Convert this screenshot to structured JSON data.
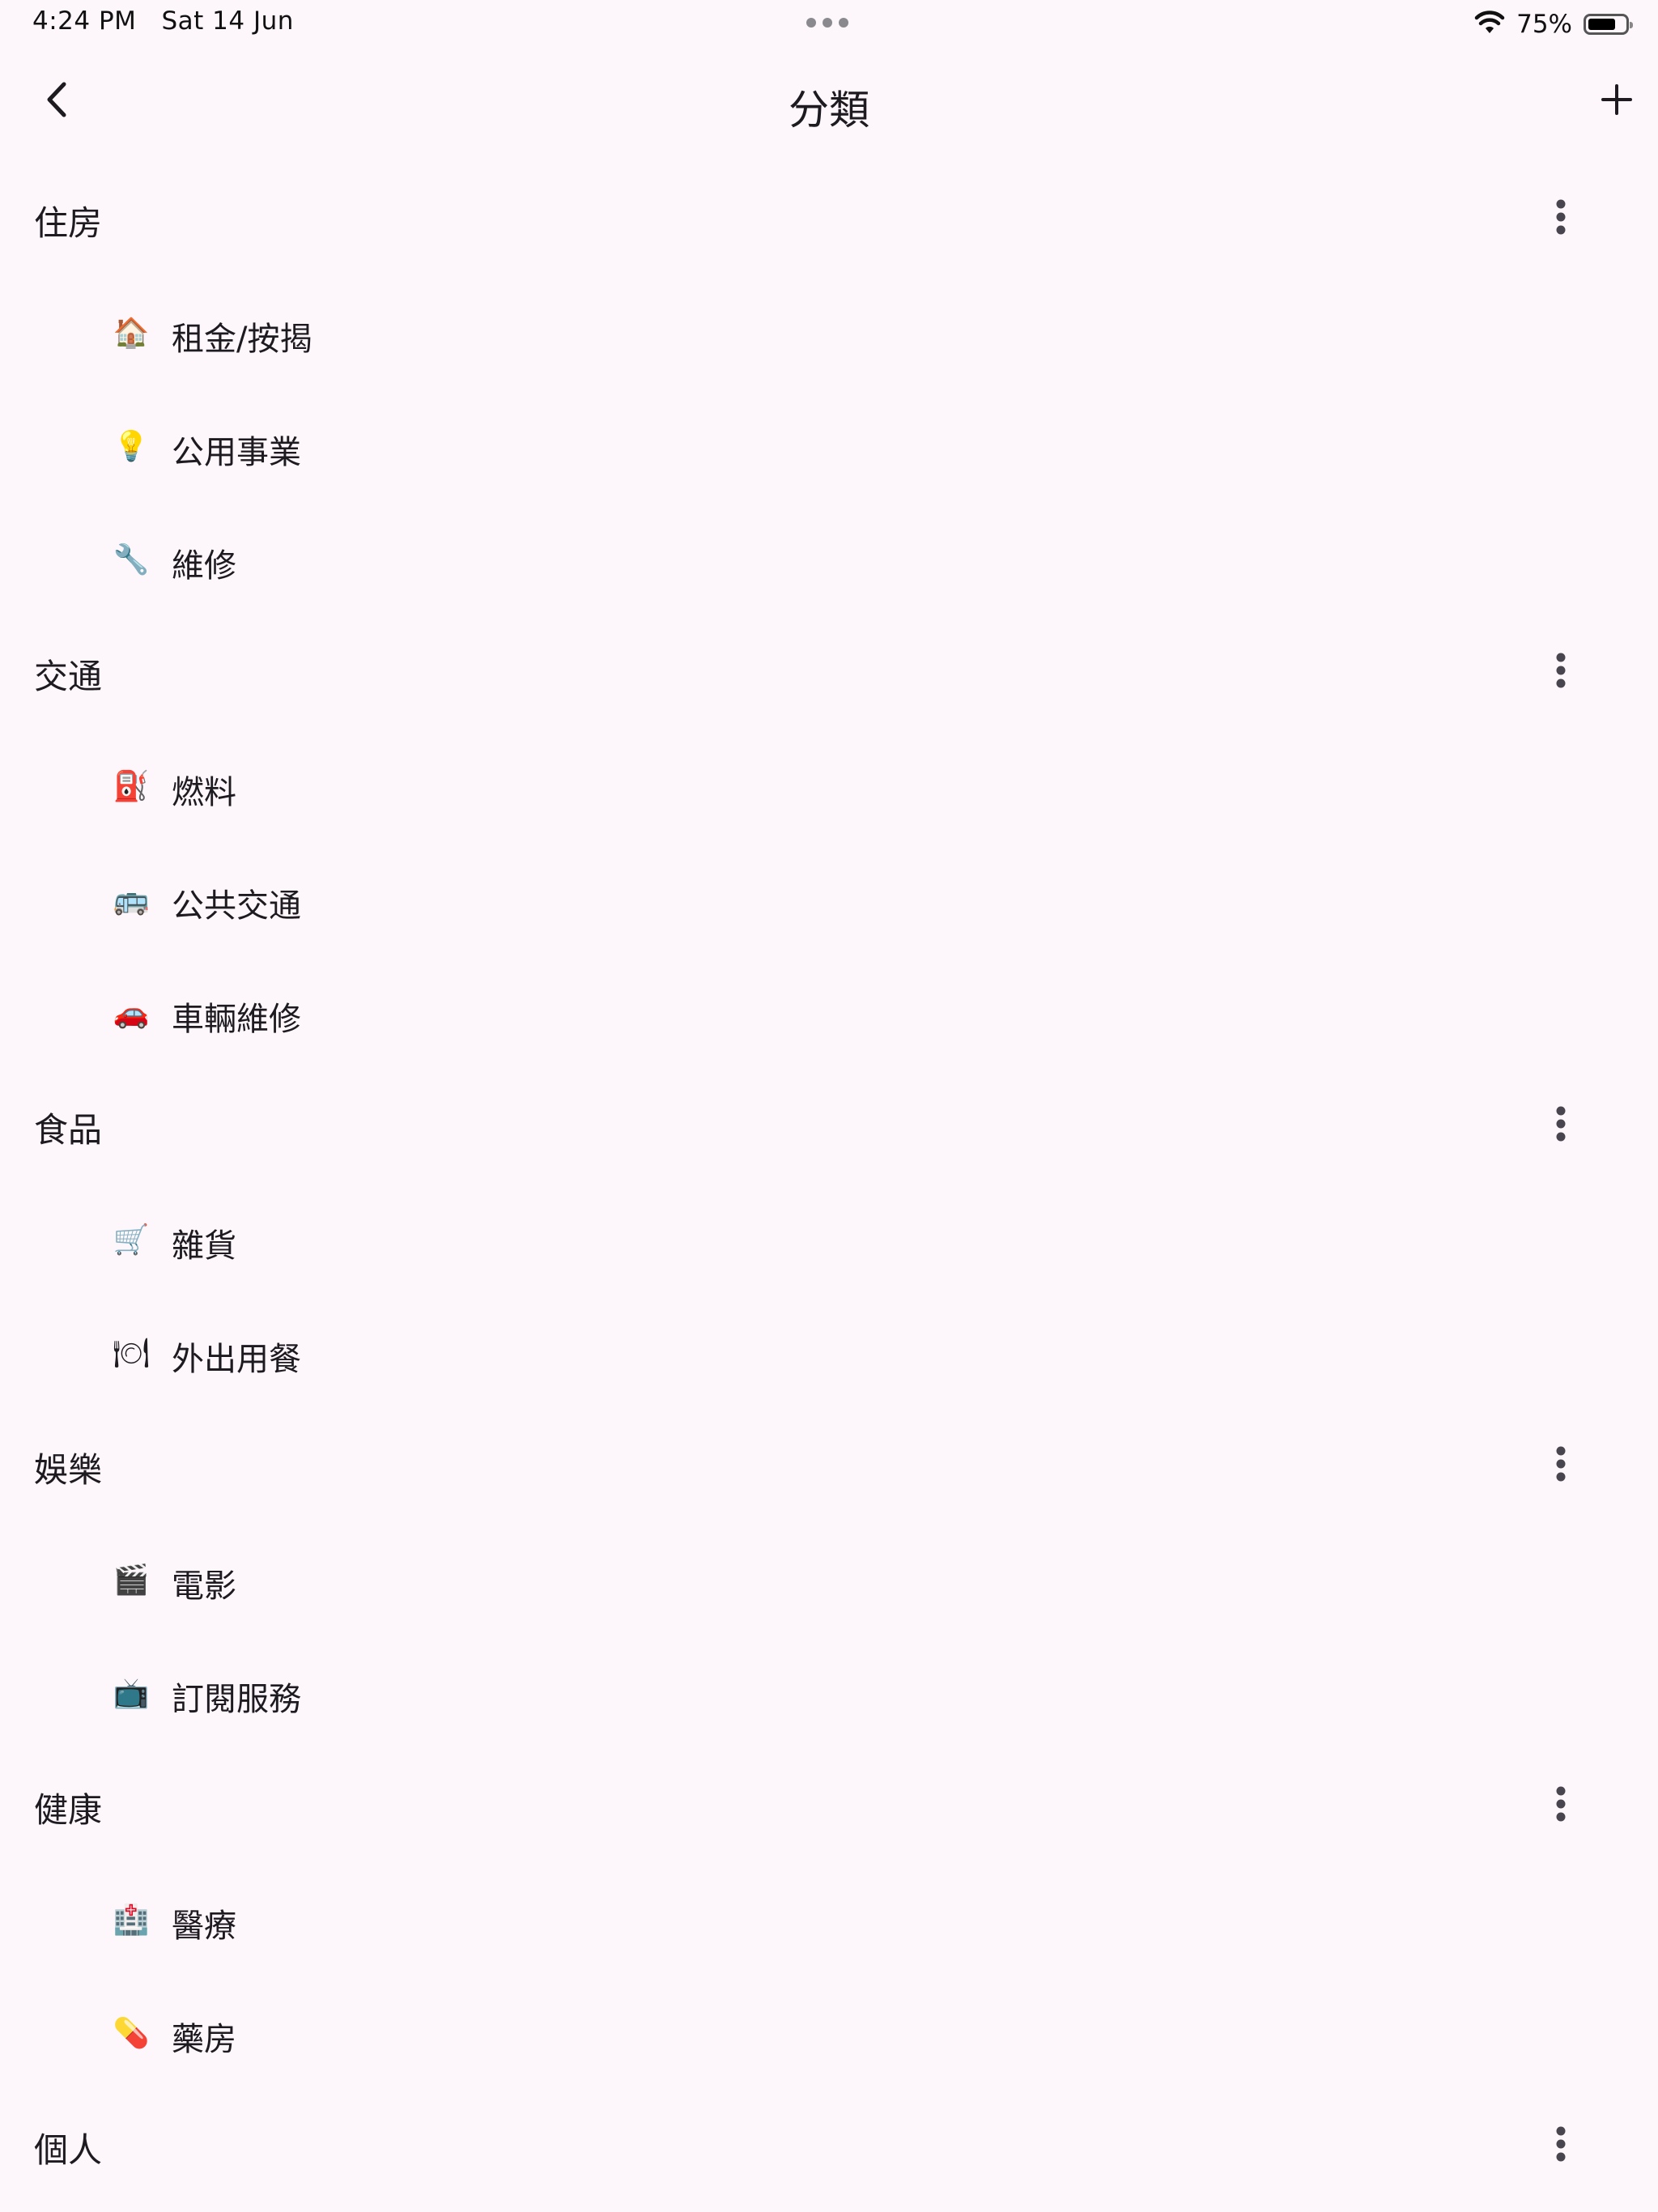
{
  "status_bar": {
    "time": "4:24 PM",
    "date": "Sat 14 Jun",
    "battery_percent": "75%",
    "battery_level": 0.75,
    "wifi_icon": "wifi-icon"
  },
  "app_bar": {
    "title": "分類",
    "back_icon": "back-arrow-icon",
    "add_icon": "add-icon"
  },
  "groups": [
    {
      "title": "住房",
      "items": [
        {
          "label": "租金/按揭",
          "icon": "house-icon",
          "emoji": "🏠"
        },
        {
          "label": "公用事業",
          "icon": "lightbulb-icon",
          "emoji": "💡"
        },
        {
          "label": "維修",
          "icon": "wrench-icon",
          "emoji": "🔧"
        }
      ]
    },
    {
      "title": "交通",
      "items": [
        {
          "label": "燃料",
          "icon": "fuel-pump-icon",
          "emoji": "⛽"
        },
        {
          "label": "公共交通",
          "icon": "bus-icon",
          "emoji": "🚌"
        },
        {
          "label": "車輛維修",
          "icon": "car-icon",
          "emoji": "🚗"
        }
      ]
    },
    {
      "title": "食品",
      "items": [
        {
          "label": "雜貨",
          "icon": "shopping-cart-icon",
          "emoji": "🛒"
        },
        {
          "label": "外出用餐",
          "icon": "plate-cutlery-icon",
          "emoji": "🍽"
        }
      ]
    },
    {
      "title": "娛樂",
      "items": [
        {
          "label": "電影",
          "icon": "clapperboard-icon",
          "emoji": "🎬"
        },
        {
          "label": "訂閱服務",
          "icon": "tv-icon",
          "emoji": "📺"
        }
      ]
    },
    {
      "title": "健康",
      "items": [
        {
          "label": "醫療",
          "icon": "hospital-icon",
          "emoji": "🏥"
        },
        {
          "label": "藥房",
          "icon": "pill-icon",
          "emoji": "💊"
        }
      ]
    },
    {
      "title": "個人",
      "items": []
    }
  ],
  "colors": {
    "background": "#fdf7fc",
    "text": "#1d1b20",
    "icon": "#49454f"
  }
}
